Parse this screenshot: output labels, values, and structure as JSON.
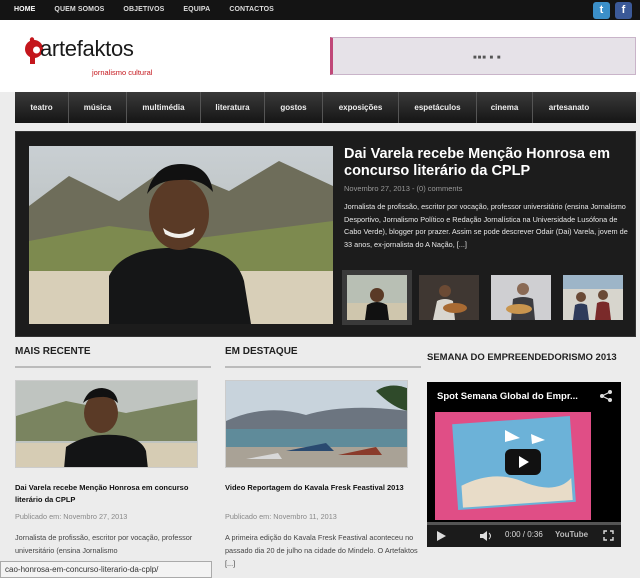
{
  "topnav": {
    "items": [
      "HOME",
      "QUEM SOMOS",
      "OBJETIVOS",
      "EQUIPA",
      "CONTACTOS"
    ]
  },
  "social": {
    "twitter_icon": "twitter-icon",
    "facebook_icon": "facebook-icon",
    "twitter_glyph": "t",
    "facebook_glyph": "f"
  },
  "logo": {
    "text": "artefaktos",
    "subtitle": "jornalismo cultural",
    "brand_color": "#c4161c"
  },
  "ad": {
    "dots": "■■■ ■ ■"
  },
  "categories": [
    "teatro",
    "música",
    "multimédia",
    "literatura",
    "gostos",
    "exposições",
    "espetáculos",
    "cinema",
    "artesanato"
  ],
  "featured": {
    "title": "Dai Varela recebe Menção Honrosa em concurso literário da CPLP",
    "meta": "Novembro 27, 2013 - (0) comments",
    "excerpt": "Jornalista de profissão, escritor por vocação, professor universitário (ensina Jornalismo Desportivo, Jornalismo Político e Redação Jornalística na Universidade Lusófona de Cabo Verde), blogger por prazer. Assim se pode descrever Odair (Dai) Varela, jovem de 33 anos, ex-jornalista do A Nação, [...]"
  },
  "recent": {
    "heading": "MAIS RECENTE",
    "title": "Dai Varela recebe Menção Honrosa em concurso literário da CPLP",
    "date": "Publicado em: Novembro 27, 2013",
    "excerpt": "Jornalista de profissão, escritor por vocação, professor universitário (ensina Jornalismo"
  },
  "highlight": {
    "heading": "EM DESTAQUE",
    "title": "Video Reportagem do Kavala Fresk Feastival 2013",
    "date": "Publicado em: Novembro 11, 2013",
    "excerpt": "A primeira edição do Kavala Fresk Feastival aconteceu no passado dia 20 de julho na cidade do Mindelo. O Artefaktos [...]"
  },
  "sidebar": {
    "heading": "SEMANA DO EMPREENDEDORISMO 2013",
    "video_title": "Spot Semana Global do Empr...",
    "time": "0:00 / 0:36",
    "brand": "YouTube"
  },
  "status": {
    "url": "cao-honrosa-em-concurso-literario-da-cplp/"
  }
}
